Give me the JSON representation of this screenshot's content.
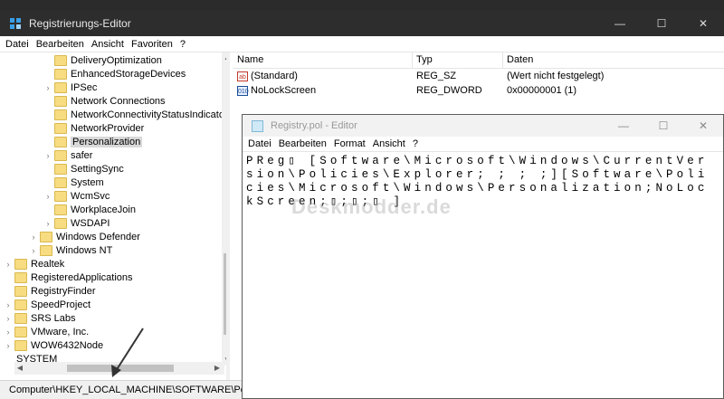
{
  "regedit": {
    "title": "Registrierungs-Editor",
    "menu": [
      "Datei",
      "Bearbeiten",
      "Ansicht",
      "Favoriten",
      "?"
    ],
    "caption": {
      "minimize": "—",
      "maximize": "☐",
      "close": "✕"
    },
    "tree": [
      {
        "label": "DeliveryOptimization",
        "exp": ""
      },
      {
        "label": "EnhancedStorageDevices",
        "exp": ""
      },
      {
        "label": "IPSec",
        "exp": "›"
      },
      {
        "label": "Network Connections",
        "exp": ""
      },
      {
        "label": "NetworkConnectivityStatusIndicator",
        "exp": ""
      },
      {
        "label": "NetworkProvider",
        "exp": ""
      },
      {
        "label": "Personalization",
        "exp": ""
      },
      {
        "label": "safer",
        "exp": "›"
      },
      {
        "label": "SettingSync",
        "exp": ""
      },
      {
        "label": "System",
        "exp": ""
      },
      {
        "label": "WcmSvc",
        "exp": "›"
      },
      {
        "label": "WorkplaceJoin",
        "exp": ""
      },
      {
        "label": "WSDAPI",
        "exp": "›"
      },
      {
        "label": "Windows Defender",
        "exp": "›"
      },
      {
        "label": "Windows NT",
        "exp": "›"
      },
      {
        "label": "Realtek",
        "exp": "›"
      },
      {
        "label": "RegisteredApplications",
        "exp": ""
      },
      {
        "label": "RegistryFinder",
        "exp": ""
      },
      {
        "label": "SpeedProject",
        "exp": "›"
      },
      {
        "label": "SRS Labs",
        "exp": "›"
      },
      {
        "label": "VMware, Inc.",
        "exp": "›"
      },
      {
        "label": "WOW6432Node",
        "exp": "›"
      },
      {
        "label": "SYSTEM",
        "exp": "›"
      }
    ],
    "columns": {
      "name": "Name",
      "type": "Typ",
      "data": "Daten"
    },
    "values": [
      {
        "icon": "ab",
        "name": "(Standard)",
        "type": "REG_SZ",
        "data": "(Wert nicht festgelegt)"
      },
      {
        "icon": "010",
        "name": "NoLockScreen",
        "type": "REG_DWORD",
        "data": "0x00000001 (1)"
      }
    ],
    "status": "Computer\\HKEY_LOCAL_MACHINE\\SOFTWARE\\Policies\\M"
  },
  "notepad": {
    "title": "Registry.pol - Editor",
    "menu": [
      "Datei",
      "Bearbeiten",
      "Format",
      "Ansicht",
      "?"
    ],
    "caption": {
      "minimize": "—",
      "maximize": "☐",
      "close": "✕"
    },
    "content": "PReg▯ [Software\\Microsoft\\Windows\\CurrentVersion\\Policies\\Explorer; ; ; ;][Software\\Policies\\Microsoft\\Windows\\Personalization;NoLockScreen;▯;▯;▯ ]"
  },
  "watermark": "Deskmodder.de",
  "colors": {
    "regedit_titlebar": "#2d2d2d",
    "folder": "#f7dc82",
    "selection": "#d9d9d9"
  }
}
